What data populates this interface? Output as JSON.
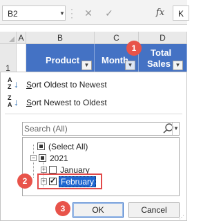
{
  "formula_bar": {
    "name_box": "B2",
    "cancel_icon": "✕",
    "enter_icon": "✓",
    "fx_label": "fx",
    "cell_value": "K"
  },
  "sheet": {
    "columns": [
      "A",
      "B",
      "C",
      "D"
    ],
    "row_number": "1",
    "headers": {
      "product": "Product",
      "month": "Month",
      "total_sales": [
        "Total",
        "Sales"
      ]
    }
  },
  "filter_menu": {
    "sort_oldest": "Sort Oldest to Newest",
    "sort_newest": "Sort Newest to Oldest",
    "search_placeholder": "Search (All)",
    "tree": {
      "select_all": "(Select All)",
      "year": "2021",
      "months": [
        "January",
        "February"
      ]
    },
    "ok_label": "OK",
    "cancel_label": "Cancel"
  },
  "callouts": [
    "1",
    "2",
    "3"
  ],
  "colors": {
    "header_fill": "#4472c4",
    "callout": "#e8534a",
    "selection": "#1e66d0"
  },
  "icons": [
    "dropdown-arrow-icon",
    "sort-ascending-icon",
    "sort-descending-icon",
    "magnifier-icon",
    "expand-icon",
    "collapse-icon"
  ]
}
